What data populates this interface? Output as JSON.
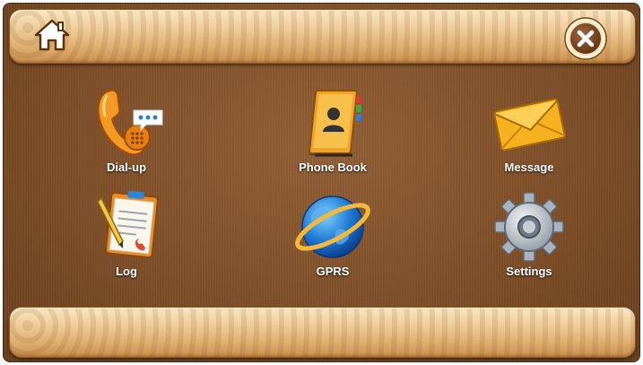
{
  "top_bar": {
    "home_icon": "home-icon",
    "close_icon": "close-icon"
  },
  "apps": [
    {
      "label": "Dial-up",
      "icon": "phone-handset-icon"
    },
    {
      "label": "Phone Book",
      "icon": "phone-book-icon"
    },
    {
      "label": "Message",
      "icon": "envelope-icon"
    },
    {
      "label": "Log",
      "icon": "call-log-clipboard-icon"
    },
    {
      "label": "GPRS",
      "icon": "globe-icon"
    },
    {
      "label": "Settings",
      "icon": "gear-icon"
    }
  ],
  "colors": {
    "background": "#7d4d27",
    "bar": "#efcd99",
    "label": "#ffffff"
  }
}
